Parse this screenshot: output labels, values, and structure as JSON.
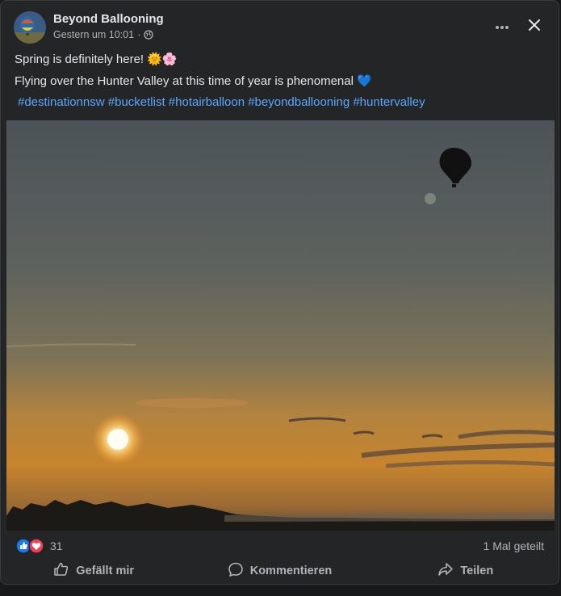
{
  "post": {
    "page_name": "Beyond Ballooning",
    "timestamp": "Gestern um 10:01",
    "separator": "·",
    "line1": "Spring is definitely here! 🌞🌸",
    "line2": "Flying over the Hunter Valley at this time of year is phenomenal 💙",
    "hashtags": [
      "#destinationnsw",
      "#bucketlist",
      "#hotairballoon",
      "#beyondballooning",
      "#huntervalley"
    ]
  },
  "stats": {
    "reaction_count": "31",
    "shares": "1 Mal geteilt"
  },
  "actions": {
    "like": "Gefällt mir",
    "comment": "Kommentieren",
    "share": "Teilen"
  },
  "icons": {
    "more": "more-horizontal-icon",
    "close": "close-icon",
    "audience": "globe-icon"
  },
  "colors": {
    "card": "#242526",
    "link": "#5aa7ff",
    "like": "#1877f2",
    "love": "#f33e58"
  }
}
